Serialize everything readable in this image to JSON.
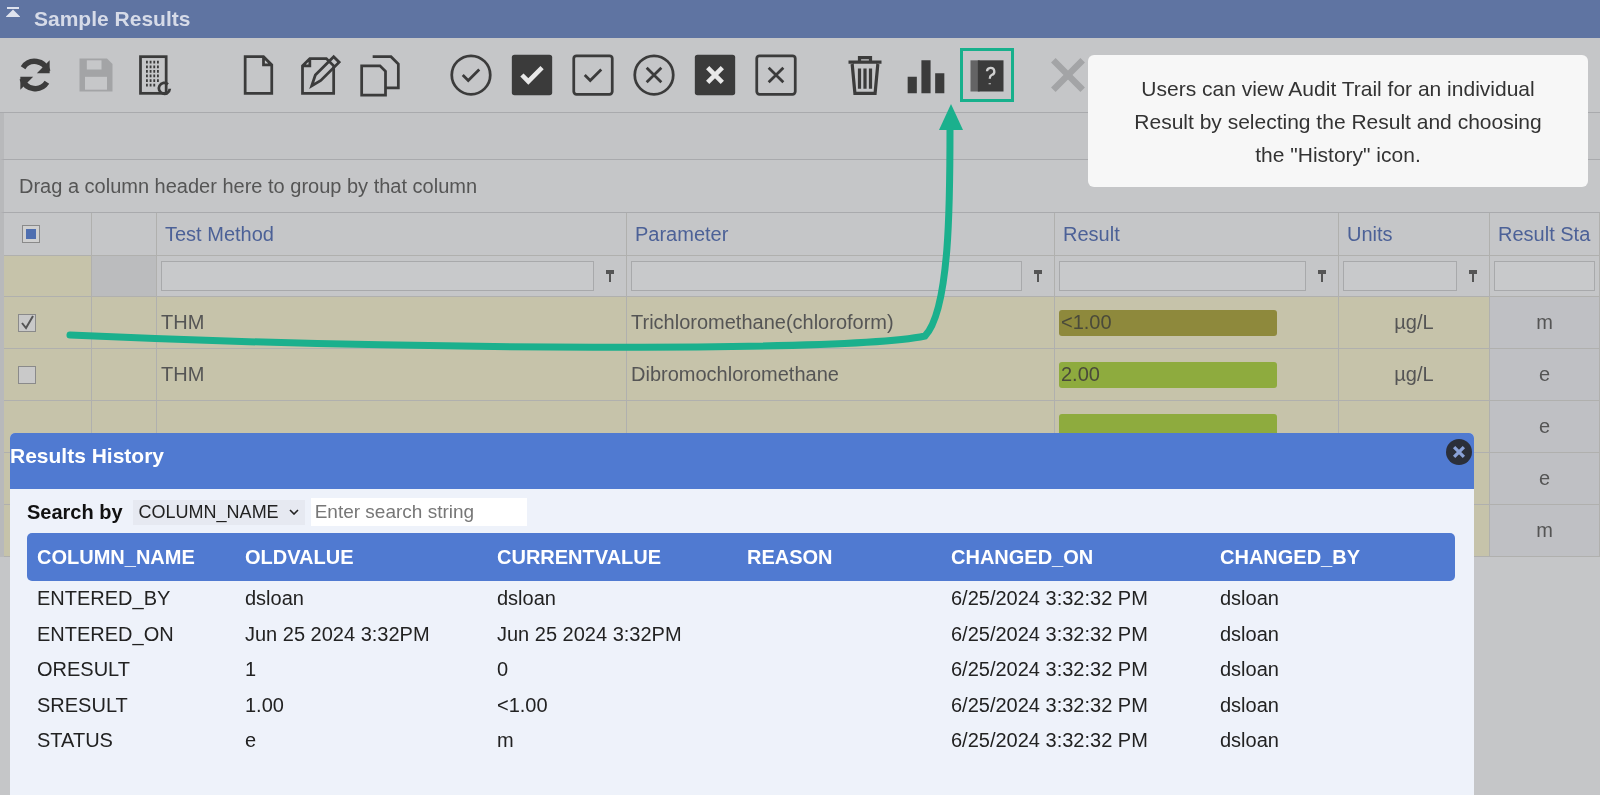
{
  "panel": {
    "title": "Sample Results",
    "collapsed": false
  },
  "toolbar": [
    {
      "kind": "refresh",
      "disabled": false,
      "highlighted": false
    },
    {
      "kind": "save",
      "disabled": true,
      "highlighted": false
    },
    {
      "kind": "report",
      "disabled": false,
      "highlighted": false
    },
    {
      "kind": "new",
      "disabled": false,
      "highlighted": false
    },
    {
      "kind": "edit",
      "disabled": false,
      "highlighted": false
    },
    {
      "kind": "copy",
      "disabled": false,
      "highlighted": false
    },
    {
      "kind": "approve-circle",
      "disabled": false,
      "highlighted": false
    },
    {
      "kind": "approve-filled",
      "disabled": false,
      "highlighted": false
    },
    {
      "kind": "approve-square",
      "disabled": false,
      "highlighted": false
    },
    {
      "kind": "reject-circle",
      "disabled": false,
      "highlighted": false
    },
    {
      "kind": "reject-filled",
      "disabled": false,
      "highlighted": false
    },
    {
      "kind": "reject-square",
      "disabled": false,
      "highlighted": false
    },
    {
      "kind": "delete",
      "disabled": false,
      "highlighted": false
    },
    {
      "kind": "chart",
      "disabled": false,
      "highlighted": false
    },
    {
      "kind": "history",
      "disabled": false,
      "highlighted": true
    },
    {
      "kind": "cross",
      "disabled": true,
      "highlighted": false
    }
  ],
  "group_panel": {
    "hint": "Drag a column header here to group by that column"
  },
  "grid": {
    "select_all": {
      "partial": true
    },
    "columns": [
      {
        "label": "Test Method"
      },
      {
        "label": "Parameter"
      },
      {
        "label": "Result"
      },
      {
        "label": "Units"
      },
      {
        "label": "Result Sta"
      }
    ],
    "rows": [
      {
        "checked": true,
        "test_method": "THM",
        "parameter": "Trichloromethane(chloroform)",
        "result": "<1.00",
        "color": "#8e893c",
        "units": "µg/L",
        "status": "m"
      },
      {
        "checked": false,
        "test_method": "THM",
        "parameter": "Dibromochloromethane",
        "result": "2.00",
        "color": "#8eab3e",
        "units": "µg/L",
        "status": "e"
      },
      {
        "status": "e",
        "color": "#8eab3e"
      },
      {
        "status": "e"
      },
      {
        "status": "m"
      }
    ]
  },
  "callout": {
    "text": "Users can view Audit Trail for an individual Result by selecting the Result and choosing the \"History\" icon."
  },
  "history_dialog": {
    "title": "Results History",
    "search_label": "Search by",
    "search_column": "COLUMN_NAME",
    "search_placeholder": "Enter search string",
    "columns": [
      "COLUMN_NAME",
      "OLDVALUE",
      "CURRENTVALUE",
      "REASON",
      "CHANGED_ON",
      "CHANGED_BY"
    ],
    "rows": [
      [
        "ENTERED_BY",
        "dsloan",
        "dsloan",
        "",
        "6/25/2024 3:32:32 PM",
        "dsloan"
      ],
      [
        "ENTERED_ON",
        "Jun 25 2024 3:32PM",
        "Jun 25 2024 3:32PM",
        "",
        "6/25/2024 3:32:32 PM",
        "dsloan"
      ],
      [
        "ORESULT",
        "1",
        "0",
        "",
        "6/25/2024 3:32:32 PM",
        "dsloan"
      ],
      [
        "SRESULT",
        "1.00",
        "<1.00",
        "",
        "6/25/2024 3:32:32 PM",
        "dsloan"
      ],
      [
        "STATUS",
        "e",
        "m",
        "",
        "6/25/2024 3:32:32 PM",
        "dsloan"
      ]
    ]
  }
}
